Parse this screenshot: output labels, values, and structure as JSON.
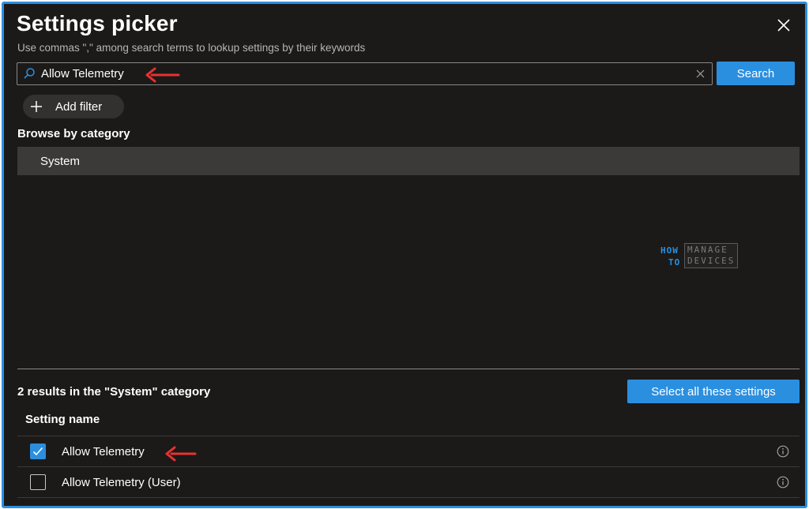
{
  "header": {
    "title": "Settings picker",
    "subtitle": "Use commas \",\" among search terms to lookup settings by their keywords"
  },
  "search": {
    "value": "Allow Telemetry",
    "button_label": "Search"
  },
  "filter": {
    "add_filter_label": "Add filter"
  },
  "browse": {
    "heading": "Browse by category",
    "categories": [
      {
        "label": "System",
        "selected": true
      }
    ]
  },
  "watermark": {
    "line1": "HOW",
    "line2": "TO",
    "line3": "MANAGE",
    "line4": "DEVICES"
  },
  "results": {
    "summary": "2 results in the \"System\" category",
    "select_all_label": "Select all these settings",
    "column_header": "Setting name",
    "rows": [
      {
        "label": "Allow Telemetry",
        "checked": true,
        "icon": "info-icon"
      },
      {
        "label": "Allow Telemetry (User)",
        "checked": false,
        "icon": "info-icon"
      }
    ]
  },
  "colors": {
    "panel_bg": "#1b1a19",
    "accent": "#2b8fe0",
    "category_bg": "#3b3a39",
    "annotation_arrow": "#e8322f"
  }
}
